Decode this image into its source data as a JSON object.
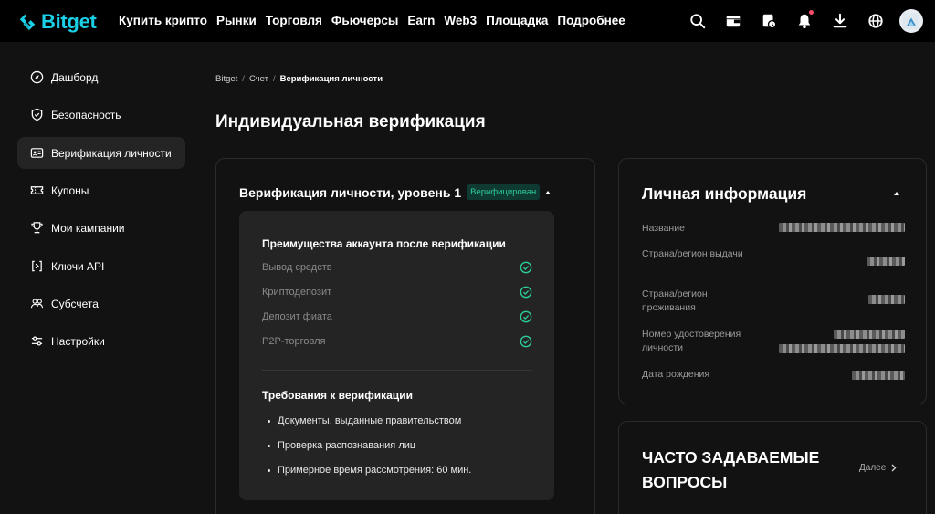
{
  "brand": {
    "name": "Bitget",
    "accent": "#1ad0e6"
  },
  "nav": {
    "items": [
      {
        "label": "Купить крипто"
      },
      {
        "label": "Рынки"
      },
      {
        "label": "Торговля"
      },
      {
        "label": "Фьючерсы"
      },
      {
        "label": "Earn"
      },
      {
        "label": "Web3"
      },
      {
        "label": "Площадка"
      },
      {
        "label": "Подробнее"
      }
    ],
    "icons": [
      "search-icon",
      "wallet-icon",
      "orders-icon",
      "bell-icon",
      "download-icon",
      "globe-icon",
      "avatar"
    ]
  },
  "sidebar": {
    "items": [
      {
        "label": "Дашборд",
        "icon": "compass-icon"
      },
      {
        "label": "Безопасность",
        "icon": "shield-icon"
      },
      {
        "label": "Верификация личности",
        "icon": "id-card-icon",
        "active": true
      },
      {
        "label": "Купоны",
        "icon": "coupon-icon"
      },
      {
        "label": "Мои кампании",
        "icon": "trophy-icon"
      },
      {
        "label": "Ключи API",
        "icon": "api-key-icon"
      },
      {
        "label": "Субсчета",
        "icon": "users-icon"
      },
      {
        "label": "Настройки",
        "icon": "sliders-icon"
      }
    ]
  },
  "breadcrumb": {
    "items": [
      "Bitget",
      "Счет",
      "Верификация личности"
    ],
    "separator": "/"
  },
  "page": {
    "title": "Индивидуальная верификация"
  },
  "verification": {
    "level_title": "Верификация личности, уровень 1",
    "badge": "Верифицирован",
    "badge_color": "#2ecc9a",
    "benefits_title": "Преимущества аккаунта после верификации",
    "benefits": [
      {
        "label": "Вывод средств"
      },
      {
        "label": "Криптодепозит"
      },
      {
        "label": "Депозит фиата"
      },
      {
        "label": "P2P-торговля"
      }
    ],
    "requirements_title": "Требования к верификации",
    "requirements": [
      "Документы, выданные правительством",
      "Проверка распознавания лиц",
      "Примерное время рассмотрения: 60 мин."
    ]
  },
  "personal_info": {
    "title": "Личная информация",
    "fields": [
      {
        "label": "Название"
      },
      {
        "label": "Страна/регион выдачи"
      },
      {
        "label": "Страна/регион проживания"
      },
      {
        "label": "Номер удостоверения личности"
      },
      {
        "label": "Дата рождения"
      }
    ]
  },
  "faq": {
    "title": "ЧАСТО ЗАДАВАЕМЫЕ ВОПРОСЫ",
    "more_label": "Далее"
  }
}
